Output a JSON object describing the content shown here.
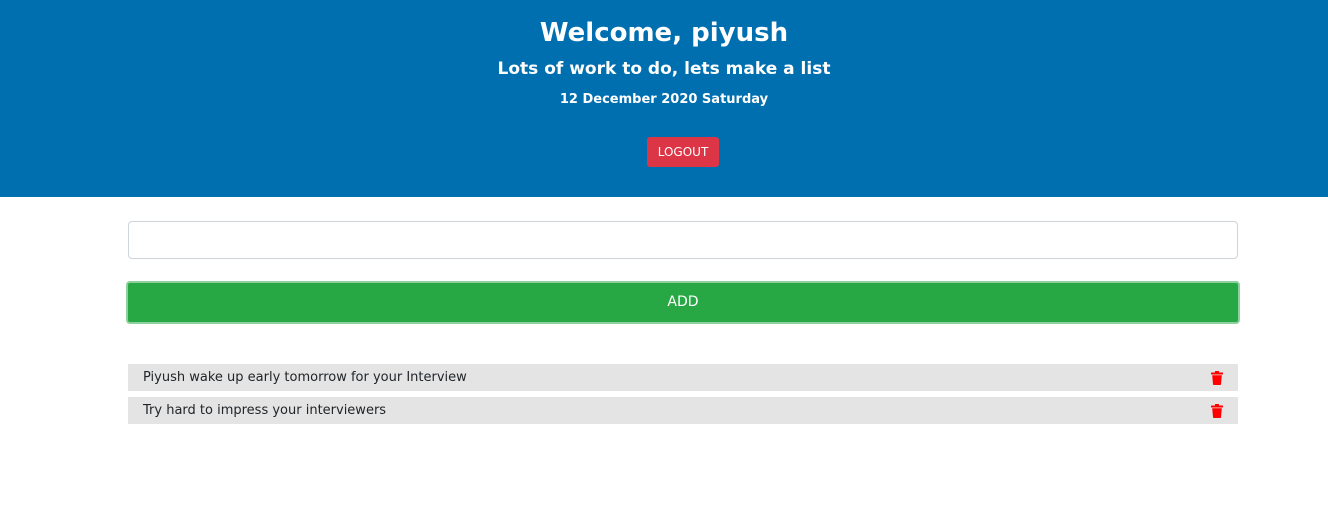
{
  "header": {
    "title": "Welcome, piyush",
    "subtitle": "Lots of work to do, lets make a list",
    "date": "12 December 2020 Saturday",
    "logout_label": "LOGOUT"
  },
  "form": {
    "input_value": "",
    "add_label": "ADD"
  },
  "tasks": [
    {
      "text": "Piyush wake up early tomorrow for your Interview",
      "icon": "trash-icon"
    },
    {
      "text": "Try hard to impress your interviewers",
      "icon": "trash-icon"
    }
  ],
  "colors": {
    "header_bg": "#006fb0",
    "logout_bg": "#dc3545",
    "add_bg": "#28a745",
    "task_bg": "#e4e4e4",
    "trash_icon": "#ff0000"
  }
}
